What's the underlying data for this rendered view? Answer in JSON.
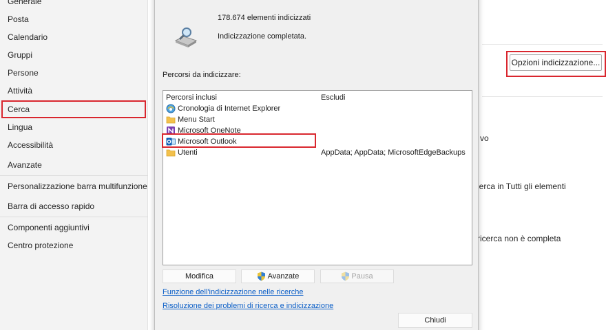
{
  "sidebar": {
    "items": [
      {
        "label": "Generale"
      },
      {
        "label": "Posta"
      },
      {
        "label": "Calendario"
      },
      {
        "label": "Gruppi"
      },
      {
        "label": "Persone"
      },
      {
        "label": "Attività"
      },
      {
        "label": "Cerca"
      },
      {
        "label": "Lingua"
      },
      {
        "label": "Accessibilità"
      },
      {
        "label": "Avanzate"
      },
      {
        "label": "Personalizzazione barra multifunzione"
      },
      {
        "label": "Barra di accesso rapido"
      },
      {
        "label": "Componenti aggiuntivi"
      },
      {
        "label": "Centro protezione"
      }
    ]
  },
  "background": {
    "options_button": "Opzioni indicizzazione...",
    "partial_1": "vo",
    "partial_2": "ricerca in Tutti gli elementi",
    "partial_3": "a ricerca non è completa"
  },
  "dialog": {
    "indexed_count": "178.674 elementi indicizzati",
    "status": "Indicizzazione completata.",
    "paths_label": "Percorsi da indicizzare:",
    "columns": {
      "included": "Percorsi inclusi",
      "exclude": "Escludi"
    },
    "rows": [
      {
        "name": "Cronologia di Internet Explorer",
        "icon": "ie-history-icon",
        "exclude": ""
      },
      {
        "name": "Menu Start",
        "icon": "folder-icon",
        "exclude": ""
      },
      {
        "name": "Microsoft OneNote",
        "icon": "onenote-icon",
        "exclude": ""
      },
      {
        "name": "Microsoft Outlook",
        "icon": "outlook-icon",
        "exclude": ""
      },
      {
        "name": "Utenti",
        "icon": "folder-icon",
        "exclude": "AppData; AppData; MicrosoftEdgeBackups"
      }
    ],
    "buttons": {
      "modify": "Modifica",
      "advanced": "Avanzate",
      "pause": "Pausa",
      "close": "Chiudi"
    },
    "links": {
      "how_indexing": "Funzione dell'indicizzazione nelle ricerche",
      "troubleshoot": "Risoluzione dei problemi di ricerca e indicizzazione"
    },
    "colors": {
      "highlight": "#d9262e",
      "link": "#0a5ec7"
    }
  }
}
